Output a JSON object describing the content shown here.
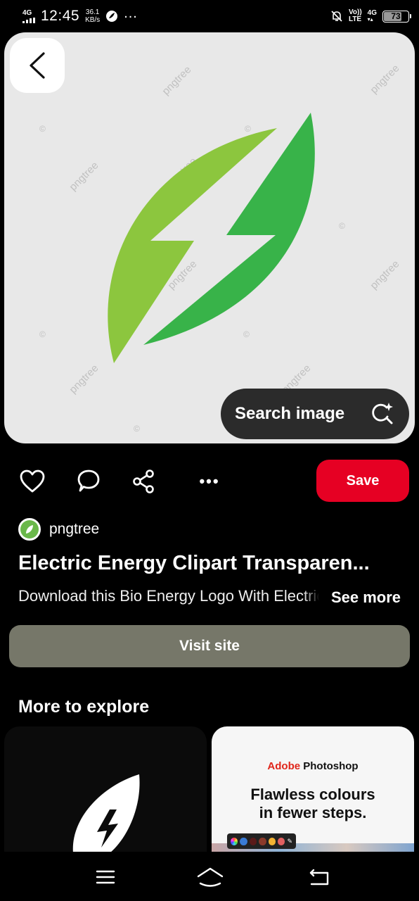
{
  "status_bar": {
    "network": "4G",
    "time": "12:45",
    "speed_value": "36.1",
    "speed_unit": "KB/s",
    "volte_line1": "Vo))",
    "volte_line2": "LTE",
    "network_right": "4G",
    "battery": "73"
  },
  "hero": {
    "watermark": "pngtree",
    "copyright": "©",
    "search_label": "Search image",
    "logo_colors": {
      "left_leaf": "#8cc63e",
      "right_leaf": "#38b349"
    }
  },
  "actions": {
    "save_label": "Save",
    "more_label": "•••",
    "save_color": "#e60023"
  },
  "pin": {
    "source_name": "pngtree",
    "title": "Electric Energy Clipart Transparen...",
    "description": "Download this Bio Energy Logo With Electric Energy",
    "see_more": "See more",
    "visit_label": "Visit site"
  },
  "explore": {
    "heading": "More to explore",
    "ad": {
      "brand_adobe": "Adobe",
      "brand_product": " Photoshop",
      "headline_line1": "Flawless colours",
      "headline_line2": "in fewer steps."
    }
  },
  "icons": {
    "back": "chevron-left-icon",
    "search_image": "visual-search-sparkle-icon",
    "like": "heart-icon",
    "comment": "comment-icon",
    "share": "share-icon",
    "menu": "menu-icon",
    "home": "home-icon",
    "back_nav": "back-arrow-icon"
  }
}
